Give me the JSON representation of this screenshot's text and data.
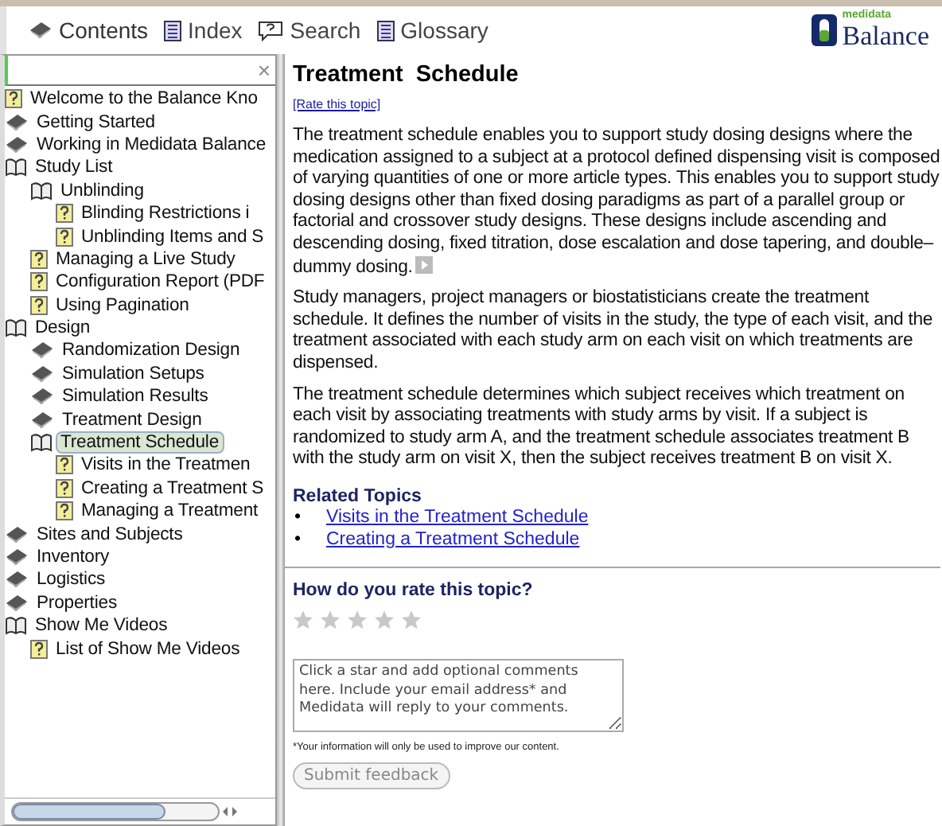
{
  "toolbar": {
    "tabs": [
      {
        "kind": "book",
        "label": "Contents",
        "selected": true
      },
      {
        "kind": "list",
        "label": "Index",
        "selected": false
      },
      {
        "kind": "speech",
        "label": "Search",
        "selected": false
      },
      {
        "kind": "list",
        "label": "Glossary",
        "selected": false
      }
    ],
    "logo": {
      "small": "medidata",
      "name": "Balance"
    }
  },
  "sidebar": {
    "search": {
      "clear": "×"
    },
    "tree": [
      {
        "kind": "page",
        "label": "Welcome to the Balance Kno",
        "selected": false
      },
      {
        "kind": "book",
        "label": "Getting Started",
        "selected": false
      },
      {
        "kind": "book",
        "label": "Working in Medidata Balance",
        "selected": false
      },
      {
        "kind": "open",
        "label": "Study List",
        "selected": false,
        "children": [
          {
            "kind": "open",
            "label": "Unblinding",
            "selected": false,
            "children": [
              {
                "kind": "page",
                "label": "Blinding Restrictions i",
                "selected": false
              },
              {
                "kind": "page",
                "label": "Unblinding Items and S",
                "selected": false
              }
            ]
          },
          {
            "kind": "page",
            "label": "Managing a Live Study",
            "selected": false
          },
          {
            "kind": "page",
            "label": "Configuration Report (PDF",
            "selected": false
          },
          {
            "kind": "page",
            "label": "Using Pagination",
            "selected": false
          }
        ]
      },
      {
        "kind": "open",
        "label": "Design",
        "selected": false,
        "children": [
          {
            "kind": "book",
            "label": "Randomization Design",
            "selected": false
          },
          {
            "kind": "book",
            "label": "Simulation Setups",
            "selected": false
          },
          {
            "kind": "book",
            "label": "Simulation Results",
            "selected": false
          },
          {
            "kind": "book",
            "label": "Treatment Design",
            "selected": false
          },
          {
            "kind": "open",
            "label": "Treatment Schedule",
            "selected": true,
            "children": [
              {
                "kind": "page",
                "label": "Visits in the Treatmen",
                "selected": false
              },
              {
                "kind": "page",
                "label": "Creating a Treatment S",
                "selected": false
              },
              {
                "kind": "page",
                "label": "Managing a Treatment",
                "selected": false
              }
            ]
          }
        ]
      },
      {
        "kind": "book",
        "label": "Sites and Subjects",
        "selected": false
      },
      {
        "kind": "book",
        "label": "Inventory",
        "selected": false
      },
      {
        "kind": "book",
        "label": "Logistics",
        "selected": false
      },
      {
        "kind": "book",
        "label": "Properties",
        "selected": false
      },
      {
        "kind": "open",
        "label": "Show Me Videos",
        "selected": false,
        "children": [
          {
            "kind": "page",
            "label": "List of Show Me Videos",
            "selected": false
          }
        ]
      }
    ]
  },
  "article": {
    "title": "Treatment  Schedule",
    "rate_link": "[Rate this topic]",
    "paragraphs": [
      "The treatment schedule enables you to support study dosing designs where the medication assigned to a subject at a protocol defined dispensing visit is composed of varying quantities of one or more article types. This enables you to support study dosing designs other than fixed dosing paradigms as part of a parallel group or factorial and crossover study designs. These designs include ascending and descending dosing, fixed titration, dose escalation and dose tapering, and double–dummy dosing.",
      "Study managers, project managers or biostatisticians create the treatment schedule. It defines the number of visits in the study, the type of each visit, and the treatment associated with each study arm on each visit on which treatments are dispensed.",
      "The treatment schedule determines which subject receives which treatment on each visit by associating treatments with study arms by visit. If a subject is randomized to study arm A, and the treatment schedule associates treatment B with the study arm on visit X, then the subject receives treatment B on visit X."
    ],
    "related_title": "Related Topics",
    "related": [
      {
        "bullet": "•",
        "label": "Visits in the Treatment Schedule"
      },
      {
        "bullet": "•",
        "label": "Creating a Treatment Schedule"
      }
    ]
  },
  "feedback": {
    "question": "How do you rate this topic?",
    "stars": 0,
    "comment_placeholder": "Click a star and add optional comments here. Include your email address* and Medidata will reply to your comments.",
    "note": "*Your information will only be used to improve our content.",
    "submit": "Submit feedback"
  }
}
